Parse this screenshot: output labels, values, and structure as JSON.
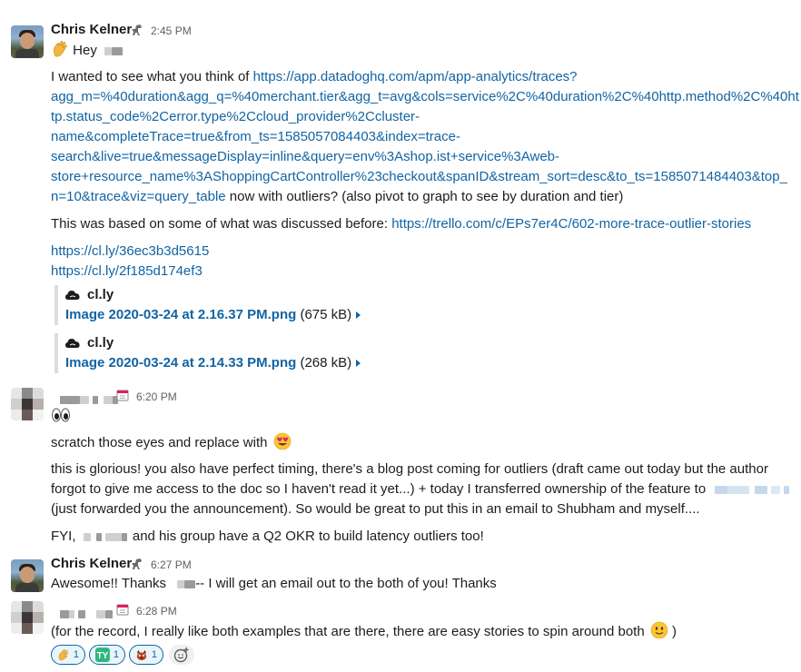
{
  "messages": [
    {
      "author": "Chris Kelner",
      "time": "2:45 PM",
      "greeting": "Hey",
      "line1_prefix": "I wanted to see what you think of ",
      "url_lines": [
        "https://app.datadoghq.com/apm/app-analytics/traces?",
        "agg_m=%40duration&agg_q=%40merchant.tier&agg_t=avg&cols=service%2C%40duration%2C%40http.method%2C%40ht",
        "tp.status_code%2Cerror.type%2Ccloud_provider%2Ccluster-",
        "name&completeTrace=true&from_ts=1585057084403&index=trace-",
        "search&live=true&messageDisplay=inline&query=env%3Ashop.ist+service%3Aweb-",
        "store+resource_name%3AShoppingCartController%23checkout&spanID&stream_sort=desc&to_ts=1585071484403&top_",
        "n=10&trace&viz=query_table"
      ],
      "url_suffix": " now with outliers? (also pivot to graph to see by duration and tier)",
      "line2_prefix": "This was based on some of what was discussed before: ",
      "line2_link": "https://trello.com/c/EPs7er4C/602-more-trace-outlier-stories",
      "links": [
        "https://cl.ly/36ec3b3d5615",
        "https://cl.ly/2f185d174ef3"
      ],
      "attachments": [
        {
          "source": "cl.ly",
          "file": "Image 2020-03-24 at 2.16.37 PM.png",
          "size": "(675 kB)"
        },
        {
          "source": "cl.ly",
          "file": "Image 2020-03-24 at 2.14.33 PM.png",
          "size": "(268 kB)"
        }
      ]
    },
    {
      "time": "6:20 PM",
      "line1": "scratch those eyes and replace with",
      "line2a": "this is glorious! you also have perfect timing, there's a blog post coming for outliers (draft came out today but the author",
      "line2b": "forgot to give me access to the doc so I haven't read it yet...) + today I transferred ownership of the feature to",
      "line2c": "(just forwarded you the announcement). So would be great to put this in an email to Shubham and myself....",
      "line3_prefix": "FYI,",
      "line3_suffix": "and his group have a Q2 OKR to build latency outliers too!"
    },
    {
      "author": "Chris Kelner",
      "time": "6:27 PM",
      "text_prefix": "Awesome!! Thanks",
      "text_suffix": "-- I will get an email out to the both of you! Thanks"
    },
    {
      "time": "6:28 PM",
      "text_prefix": "(for the record, I really like both examples that are there, there are easy stories to spin around both",
      "text_suffix": ")"
    }
  ],
  "reactions": [
    {
      "icon": "clapping-icon",
      "count": "1"
    },
    {
      "icon": "ty-icon",
      "count": "1"
    },
    {
      "icon": "dog-icon",
      "count": "1"
    }
  ],
  "colors": {
    "link": "#1264a3",
    "text": "#1d1c1d",
    "muted": "#616061"
  }
}
